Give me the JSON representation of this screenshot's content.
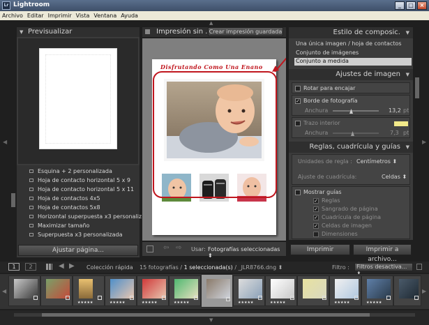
{
  "window": {
    "title": "Lightroom",
    "icon_label": "Lr"
  },
  "menu": [
    "Archivo",
    "Editar",
    "Imprimir",
    "Vista",
    "Ventana",
    "Ayuda"
  ],
  "left_panel": {
    "preview_title": "Previsualizar",
    "templates": [
      "Esquina + 2 personalizada",
      "Hoja de contacto horizontal 5 x 9",
      "Hoja de contacto horizontal 5 x 11",
      "Hoja de contactos 4x5",
      "Hoja de contactos 5x8",
      "Horizontal superpuesta x3 personaliz...",
      "Maximizar tamaño",
      "Superpuesta x3 personalizada"
    ],
    "page_setup_button": "Ajustar página..."
  },
  "center": {
    "title": "Impresión sin ...",
    "save_button": "Crear impresión guardada",
    "page_caption": "Disfrutando Como Una Enano",
    "use_label": "Usar:",
    "use_value": "Fotografías seleccionadas"
  },
  "right_panel": {
    "layout_style_title": "Estilo de composic.",
    "layout_options": [
      "Una única imagen / hoja de contactos",
      "Conjunto de imágenes",
      "Conjunto a medida"
    ],
    "image_settings_title": "Ajustes de imagen",
    "rotate_label": "Rotar para encajar",
    "photo_border_label": "Borde de fotografía",
    "width_label": "Anchura",
    "border_width_value": "13,2",
    "pt_unit": "pt",
    "inner_stroke_label": "Trazo interior",
    "inner_stroke_width_value": "7,3",
    "inner_stroke_color": "#f2ea8a",
    "rulers_title": "Reglas, cuadrícula y guías",
    "ruler_units_label": "Unidades de regla :",
    "ruler_units_value": "Centímetros",
    "grid_snap_label": "Ajuste de cuadrícula:",
    "grid_snap_value": "Celdas",
    "show_guides_label": "Mostrar guías",
    "guides": [
      "Reglas",
      "Sangrado de página",
      "Cuadrícula de página",
      "Celdas de imagen",
      "Dimensiones"
    ],
    "print_button": "Imprimir",
    "print_file_button": "Imprimir a archivo..."
  },
  "filmstrip_bar": {
    "page1": "1",
    "page2": "2",
    "collection": "Colección rápida",
    "count_prefix": "15 fotografías / ",
    "selected": "1 seleccionada(s)",
    "filename": " / _JLR8766.dng",
    "filter_label": "Filtro :",
    "filter_value": "Filtros desactiva..."
  },
  "colors": {
    "accent_red": "#c0161e",
    "panel_bg": "#3b3b3b",
    "selected_row": "#cfcfcf"
  },
  "icons": {
    "minimize": "minimize-icon",
    "maximize": "maximize-icon",
    "close": "close-icon"
  }
}
